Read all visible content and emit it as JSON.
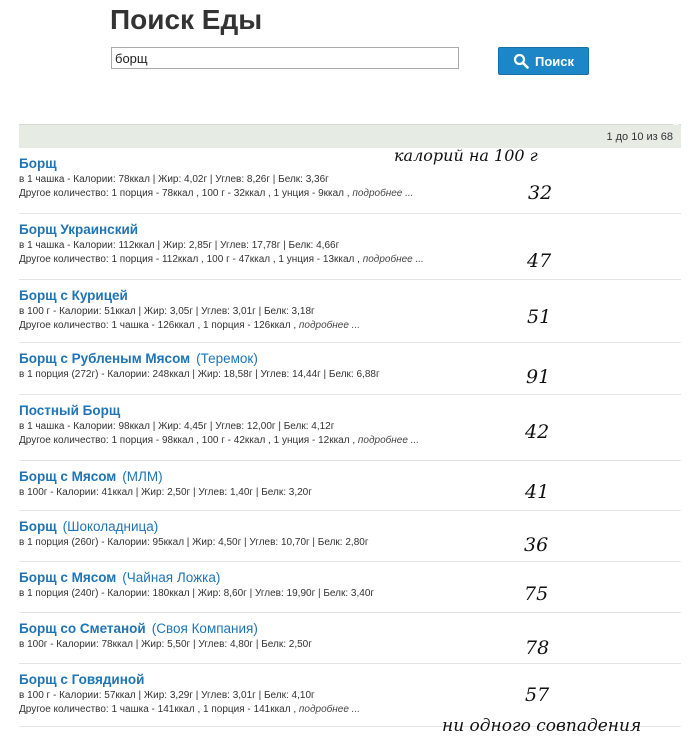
{
  "page_title": "Поиск Еды",
  "search": {
    "value": "борщ",
    "button_label": "Поиск"
  },
  "results_count": "1 до 10 из 68",
  "more_label": "подробнее ...",
  "annotations": {
    "header": "калорий на 100 г",
    "values": [
      "32",
      "47",
      "51",
      "91",
      "42",
      "41",
      "36",
      "75",
      "78",
      "57"
    ],
    "footer": "ни одного совпадения"
  },
  "items": [
    {
      "name": "Борщ",
      "brand": "",
      "line1": "в 1 чашка - Калории: 78ккал | Жир: 4,02г | Углев: 8,26г | Белк: 3,36г",
      "line2": "Другое количество: 1 порция - 78ккал , 100 г - 32ккал , 1 унция - 9ккал ,"
    },
    {
      "name": "Борщ Украинский",
      "brand": "",
      "line1": "в 1 чашка - Калории: 112ккал | Жир: 2,85г | Углев: 17,78г | Белк: 4,66г",
      "line2": "Другое количество: 1 порция - 112ккал , 100 г - 47ккал , 1 унция - 13ккал ,"
    },
    {
      "name": "Борщ с Курицей",
      "brand": "",
      "line1": "в 100 г - Калории: 51ккал | Жир: 3,05г | Углев: 3,01г | Белк: 3,18г",
      "line2": "Другое количество: 1 чашка - 126ккал , 1 порция - 126ккал ,"
    },
    {
      "name": "Борщ с Рубленым Мясом",
      "brand": "(Теремок)",
      "line1": "в 1 порция (272г) - Калории: 248ккал | Жир: 18,58г | Углев: 14,44г | Белк: 6,88г",
      "line2": ""
    },
    {
      "name": "Постный Борщ",
      "brand": "",
      "line1": "в 1 чашка - Калории: 98ккал | Жир: 4,45г | Углев: 12,00г | Белк: 4,12г",
      "line2": "Другое количество: 1 порция - 98ккал , 100 г - 42ккал , 1 унция - 12ккал ,"
    },
    {
      "name": "Борщ с Мясом",
      "brand": "(МЛМ)",
      "line1": "в 100г - Калории: 41ккал | Жир: 2,50г | Углев: 1,40г | Белк: 3,20г",
      "line2": ""
    },
    {
      "name": "Борщ",
      "brand": "(Шоколадница)",
      "line1": "в 1 порция (260г) - Калории: 95ккал | Жир: 4,50г | Углев: 10,70г | Белк: 2,80г",
      "line2": ""
    },
    {
      "name": "Борщ с Мясом",
      "brand": "(Чайная Ложка)",
      "line1": "в 1 порция (240г) - Калории: 180ккал | Жир: 8,60г | Углев: 19,90г | Белк: 3,40г",
      "line2": ""
    },
    {
      "name": "Борщ со Сметаной",
      "brand": "(Своя Компания)",
      "line1": "в 100г - Калории: 78ккал | Жир: 5,50г | Углев: 4,80г | Белк: 2,50г",
      "line2": ""
    },
    {
      "name": "Борщ с Говядиной",
      "brand": "",
      "line1": "в 100 г - Калории: 57ккал | Жир: 3,29г | Углев: 3,01г | Белк: 4,10г",
      "line2": "Другое количество: 1 чашка - 141ккал , 1 порция - 141ккал ,"
    }
  ]
}
